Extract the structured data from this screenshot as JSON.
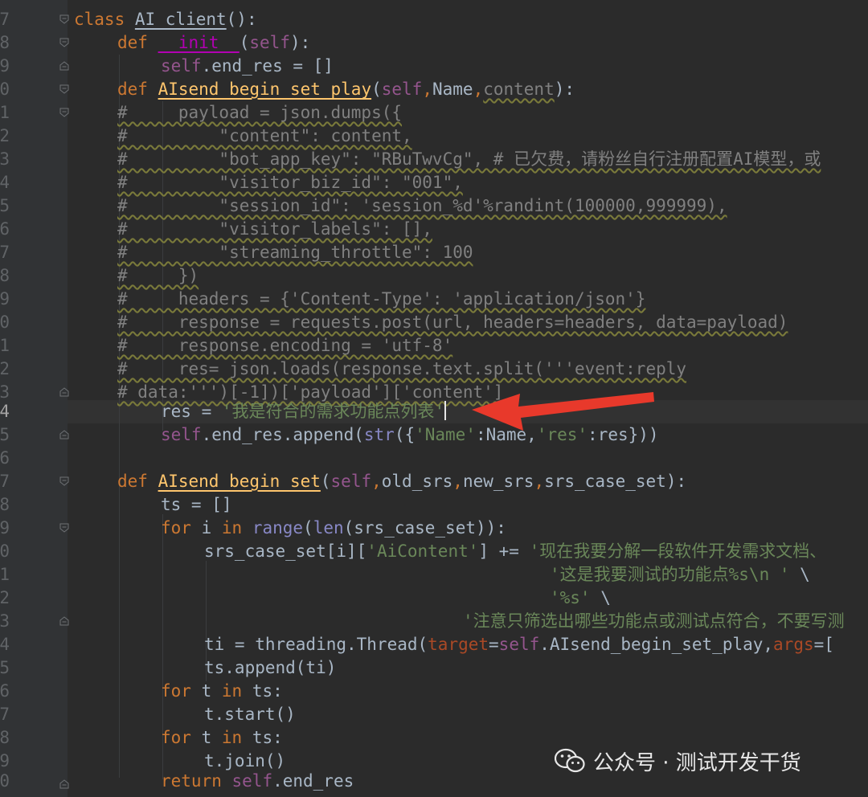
{
  "editor": {
    "line_numbers": [
      "7",
      "8",
      "9",
      "0",
      "1",
      "2",
      "3",
      "4",
      "5",
      "6",
      "7",
      "8",
      "9",
      "0",
      "1",
      "2",
      "3",
      "4",
      "5",
      "6",
      "7",
      "8",
      "9",
      "0",
      "1",
      "2",
      "3",
      "4",
      "5",
      "6",
      "7",
      "8",
      "9",
      "0"
    ],
    "code": {
      "l1": {
        "a": "class ",
        "b": "AI_client",
        "c": "():"
      },
      "l2": {
        "a": "def ",
        "b": "__init__",
        "c": "(",
        "d": "self",
        "e": "):"
      },
      "l3": {
        "a": "self",
        "b": ".end_res = []"
      },
      "l4": {
        "a": "def ",
        "b": "AIsend_begin_set_play",
        "c": "(",
        "d": "self",
        ",": ",",
        "e": "Name",
        ",2": ",",
        "f": "content",
        "g": "):"
      },
      "l5": "#     payload = json.dumps({",
      "l6": "#         \"content\": content,",
      "l7": "#         \"bot_app_key\": \"RBuTwvCg\", # 已欠费，请粉丝自行注册配置AI模型，或",
      "l8": "#         \"visitor_biz_id\": \"001\",",
      "l9": "#         \"session_id\": 'session_%d'%randint(100000,999999),",
      "l10": "#         \"visitor_labels\": [],",
      "l11": "#         \"streaming_throttle\": 100",
      "l12": "#     })",
      "l13": "#     headers = {'Content-Type': 'application/json'}",
      "l14": "#     response = requests.post(url, headers=headers, data=payload)",
      "l15": "#     response.encoding = 'utf-8'",
      "l16": "#     res= json.loads(response.text.split('''event:reply",
      "l17": "# data:''')[-1])['payload']['content']",
      "l18": {
        "a": "res = ",
        "b": "'我是符合的需求功能点列表'"
      },
      "l19": {
        "a": "self",
        "b": ".end_res.append(",
        "c": "str",
        "d": "({",
        "e": "'Name'",
        "f": ":Name,",
        "g": "'res'",
        "h": ":res}))"
      },
      "l20": "",
      "l21": {
        "a": "def ",
        "b": "AIsend_begin_set",
        "c": "(",
        "d": "self",
        ",": ",",
        "e": "old_srs",
        ",2": ",",
        "f": "new_srs",
        ",3": ",",
        "g": "srs_case_set",
        "h": "):"
      },
      "l22": "ts = []",
      "l23": {
        "a": "for ",
        "b": "i ",
        "c": "in ",
        "d": "range",
        "e": "(",
        "f": "len",
        "g": "(srs_case_set)):"
      },
      "l24": {
        "a": "srs_case_set[i][",
        "b": "'AiContent'",
        "c": "] += ",
        "d": "'现在我要分解一段软件开发需求文档、"
      },
      "l25": {
        "a": "'这是我要测试的功能点%s\\n '",
        "b": " \\"
      },
      "l26": {
        "a": "'%s'",
        "b": " \\"
      },
      "l27": "'注意只筛选出哪些功能点或测试点符合，不要写测",
      "l28": {
        "a": "ti = threading.Thread(",
        "b": "target",
        "c": "=",
        "d": "self",
        "e": ".AIsend_begin_set_play,",
        "f": "args",
        "g": "=["
      },
      "l29": "ts.append(ti)",
      "l30": {
        "a": "for ",
        "b": "t ",
        "c": "in ",
        "d": "ts:"
      },
      "l31": "t.start()",
      "l32": {
        "a": "for ",
        "b": "t ",
        "c": "in ",
        "d": "ts:"
      },
      "l33": "t.join()",
      "l34": {
        "a": "return ",
        "b": "self",
        "c": ".end_res"
      }
    }
  },
  "watermark": {
    "text": "公众号 · 测试开发干货",
    "icon": "wechat-icon"
  },
  "colors": {
    "background": "#2b2b2b",
    "keyword": "#cc7832",
    "function": "#ffc66d",
    "string": "#6a8759",
    "comment": "#808080",
    "arrow": "#e8392b"
  }
}
